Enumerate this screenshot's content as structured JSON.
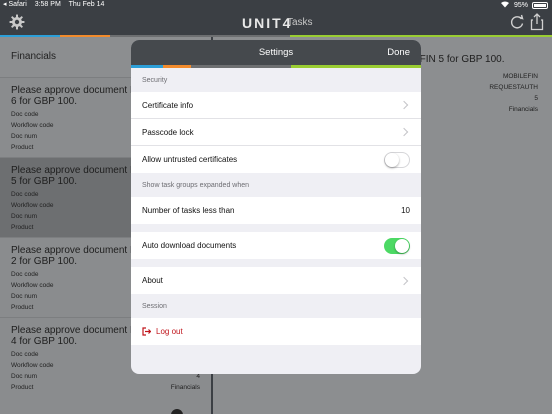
{
  "status_bar": {
    "back_app": "◂ Safari",
    "time": "3:58 PM",
    "date": "Thu Feb 14",
    "battery": "95%"
  },
  "app_bar": {
    "brand": "UNIT4",
    "subtitle": "Tasks",
    "icons": [
      "gear-icon",
      "refresh-icon",
      "share-icon"
    ]
  },
  "colors": {
    "stripe": [
      "#2c9fd8",
      "#f28b2c",
      "#6d6f71",
      "#9acd32"
    ],
    "toggle_on": "#4cd964",
    "logout": "#c0141b"
  },
  "list": {
    "heading": "Financials",
    "items": [
      {
        "title": "Please approve document P MOBILEFIN 6 for GBP 100.",
        "fields": [
          {
            "label": "Doc code",
            "value": ""
          },
          {
            "label": "Workflow code",
            "value": ""
          },
          {
            "label": "Doc num",
            "value": ""
          },
          {
            "label": "Product",
            "value": ""
          }
        ]
      },
      {
        "title": "Please approve document P MOBILEFIN 5 for GBP 100.",
        "fields": [
          {
            "label": "Doc code",
            "value": ""
          },
          {
            "label": "Workflow code",
            "value": ""
          },
          {
            "label": "Doc num",
            "value": ""
          },
          {
            "label": "Product",
            "value": ""
          }
        ]
      },
      {
        "title": "Please approve document P MOBILEFIN 2 for GBP 100.",
        "fields": [
          {
            "label": "Doc code",
            "value": ""
          },
          {
            "label": "Workflow code",
            "value": ""
          },
          {
            "label": "Doc num",
            "value": ""
          },
          {
            "label": "Product",
            "value": ""
          }
        ]
      },
      {
        "title": "Please approve document P MOBILEFIN 4 for GBP 100.",
        "fields": [
          {
            "label": "Doc code",
            "value": ""
          },
          {
            "label": "Workflow code",
            "value": ""
          },
          {
            "label": "Doc num",
            "value": "4"
          },
          {
            "label": "Product",
            "value": "Financials"
          }
        ]
      }
    ]
  },
  "detail": {
    "title": "EFIN 5 for GBP 100.",
    "values": [
      "MOBILEFIN",
      "REQUESTAUTH",
      "5",
      "Financials"
    ]
  },
  "settings": {
    "title": "Settings",
    "done": "Done",
    "security_header": "Security",
    "certificate_info": "Certificate info",
    "passcode_lock": "Passcode lock",
    "allow_untrusted": "Allow untrusted certificates",
    "allow_untrusted_on": false,
    "show_expanded_header": "Show task groups expanded when",
    "tasks_less_than_label": "Number of tasks less than",
    "tasks_less_than_value": "10",
    "auto_download": "Auto download documents",
    "auto_download_on": true,
    "about": "About",
    "session_header": "Session",
    "log_out": "Log out"
  }
}
